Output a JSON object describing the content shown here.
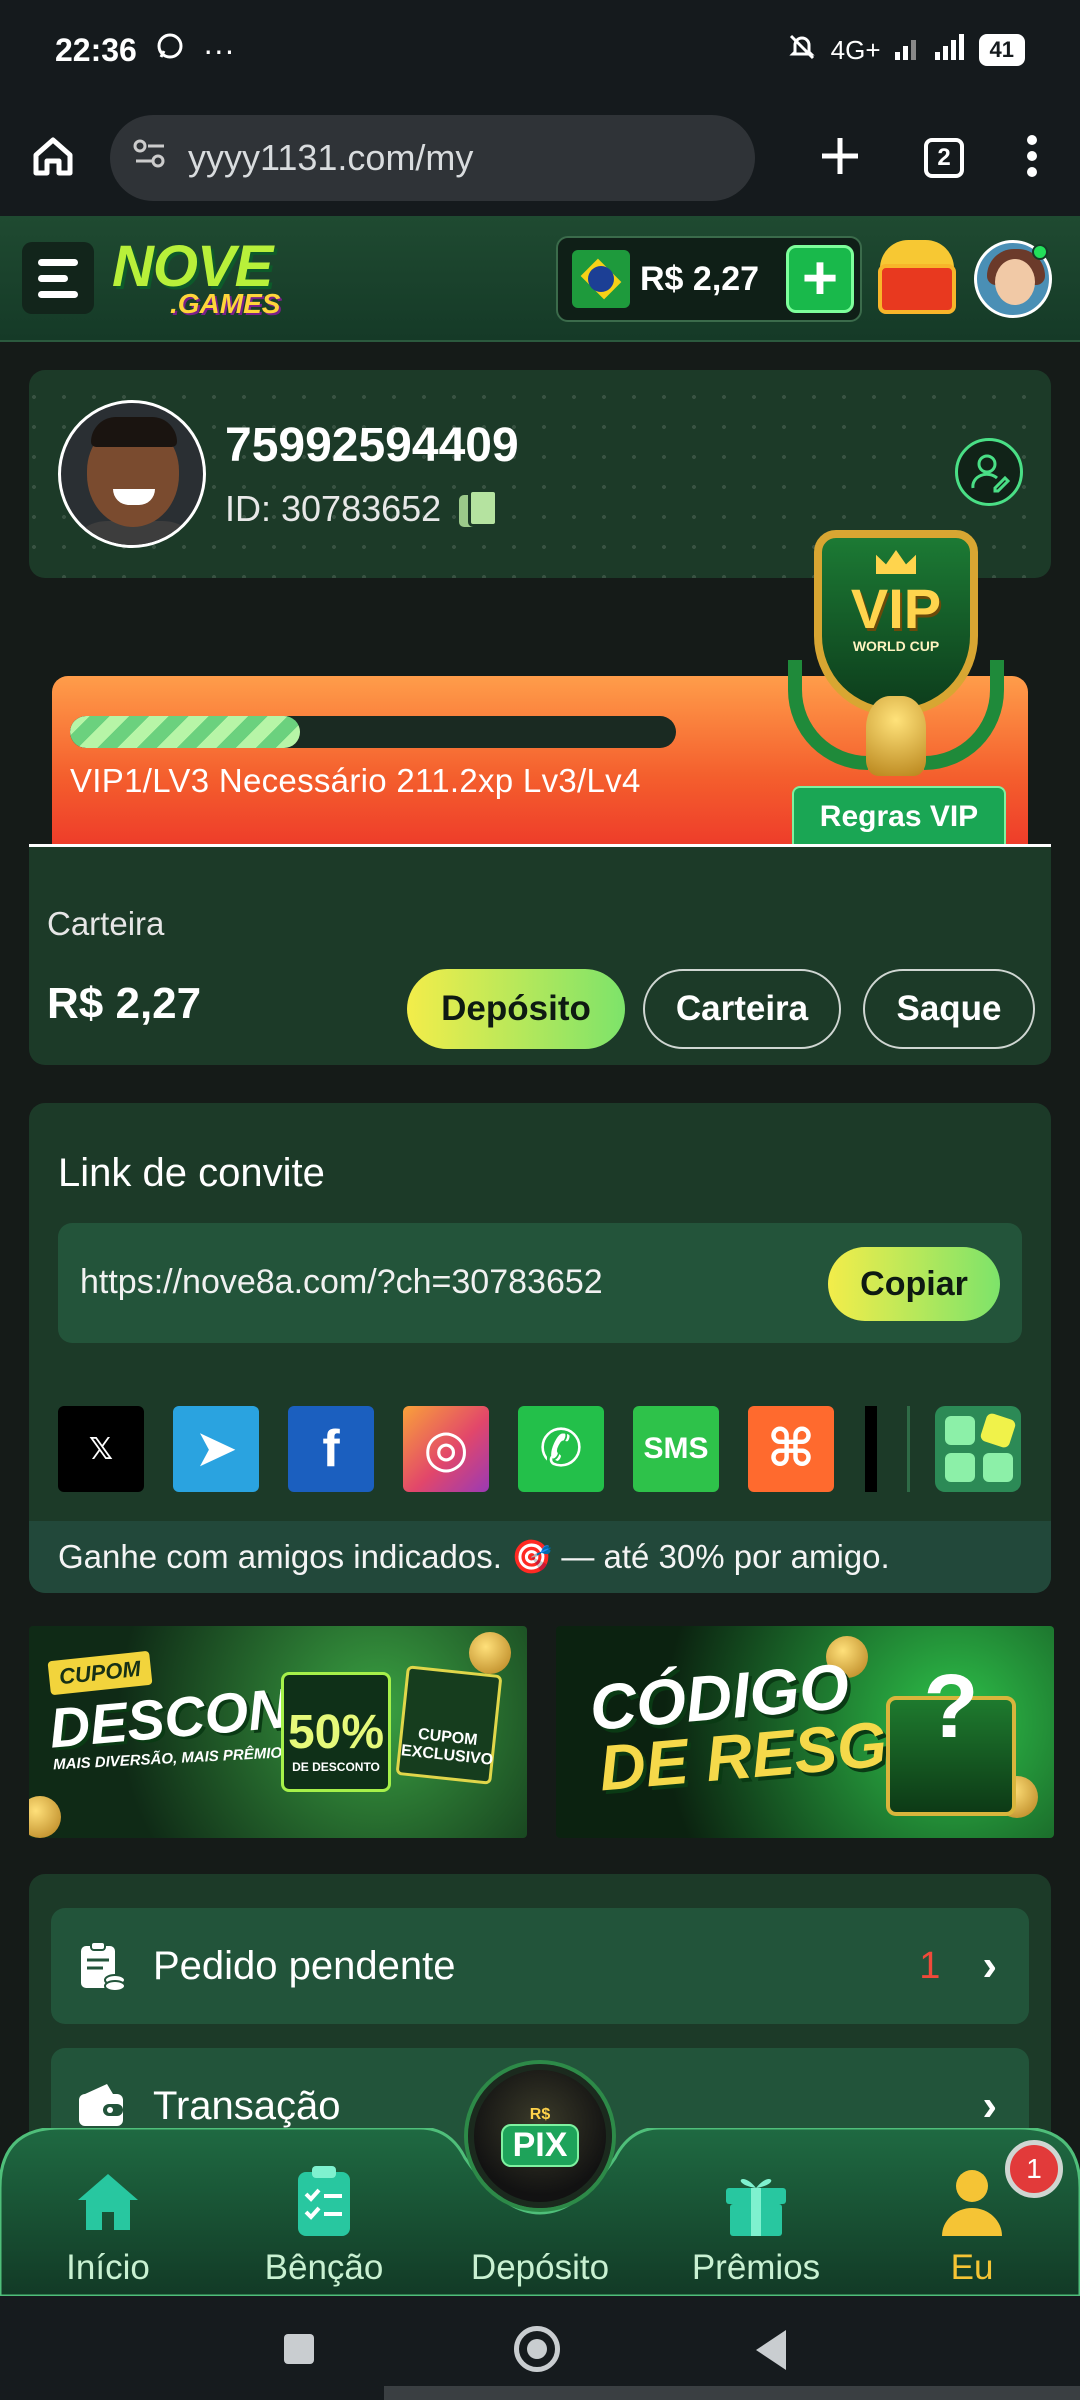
{
  "status_bar": {
    "time": "22:36",
    "dots": "···",
    "network": "4G+",
    "battery": "41"
  },
  "browser": {
    "url": "yyyy1131.com/my",
    "tab_count": "2"
  },
  "header": {
    "logo_top": "NOVE",
    "logo_bottom": ".GAMES",
    "balance": "R$ 2,27",
    "add_symbol": "+"
  },
  "profile": {
    "username": "75992594409",
    "id_text": "ID: 30783652"
  },
  "vip": {
    "progress_fraction": 0.38,
    "status_text": "VIP1/LV3  Necessário 211.2xp Lv3/Lv4",
    "rules_label": "Regras VIP",
    "badge_word": "VIP",
    "badge_sub": "WORLD CUP"
  },
  "wallet": {
    "label": "Carteira",
    "amount": "R$ 2,27",
    "deposit_label": "Depósito",
    "wallet_label": "Carteira",
    "withdraw_label": "Saque"
  },
  "invite": {
    "title": "Link de convite",
    "link": "https://nove8a.com/?ch=30783652",
    "copy_label": "Copiar",
    "footer_text": "Ganhe com amigos indicados. 🎯 — até 30% por amigo.",
    "socials": [
      {
        "name": "x",
        "glyph": "𝕏",
        "color": "#000000"
      },
      {
        "name": "telegram",
        "glyph": "➤",
        "color": "#2aa3e0"
      },
      {
        "name": "facebook",
        "glyph": "f",
        "color": "#1b5fbf"
      },
      {
        "name": "instagram",
        "glyph": "◎",
        "color": "#e2476a"
      },
      {
        "name": "whatsapp",
        "glyph": "✆",
        "color": "#23c04a"
      },
      {
        "name": "sms",
        "glyph": "SMS",
        "color": "#2ec24a"
      },
      {
        "name": "kwai",
        "glyph": "⌘",
        "color": "#ff6a2e"
      }
    ]
  },
  "banners": {
    "coupon_tag": "CUPOM",
    "coupon_title": "DESCONTO",
    "coupon_sub": "MAIS DIVERSÃO, MAIS PRÊMIOS!",
    "coupon_pct": "50%",
    "coupon_pct_sub": "DE DESCONTO",
    "coupon_ticket": "CUPOM EXCLUSIVO",
    "redeem_line1": "CÓDIGO",
    "redeem_line2": "DE RESGATE"
  },
  "list": {
    "rows": [
      {
        "label": "Pedido pendente",
        "count": "1"
      },
      {
        "label": "Transação",
        "count": ""
      }
    ]
  },
  "bottom_nav": {
    "items": [
      {
        "label": "Início"
      },
      {
        "label": "Bênção"
      },
      {
        "label": "Depósito"
      },
      {
        "label": "Prêmios"
      },
      {
        "label": "Eu"
      }
    ],
    "pix_top": "R$",
    "pix_label": "PIX",
    "notification_count": "1",
    "active_color": "#f5c435"
  }
}
